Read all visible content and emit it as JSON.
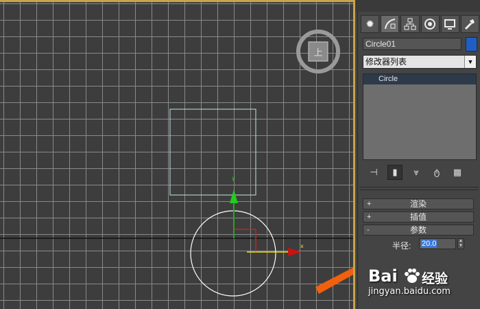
{
  "viewport": {
    "viewcube_face": "上",
    "axis_x": "x",
    "axis_y": "y"
  },
  "command_panel": {
    "tabs": [
      {
        "icon": "create-icon"
      },
      {
        "icon": "modify-icon"
      },
      {
        "icon": "hierarchy-icon"
      },
      {
        "icon": "motion-icon"
      },
      {
        "icon": "display-icon"
      },
      {
        "icon": "utilities-icon"
      }
    ],
    "object_name": "Circle01",
    "object_color": "#1f5fc4",
    "modifier_list": "修改器列表",
    "stack_items": [
      "Circle"
    ],
    "rollouts": {
      "render": {
        "sign": "+",
        "label": "渲染"
      },
      "interp": {
        "sign": "+",
        "label": "插值"
      },
      "params": {
        "sign": "-",
        "label": "参数"
      }
    },
    "radius_label": "半径:",
    "radius_value": "20.0"
  },
  "watermark": {
    "brand": "Bai",
    "brand_suffix": "经验",
    "url": "jingyan.baidu.com"
  }
}
